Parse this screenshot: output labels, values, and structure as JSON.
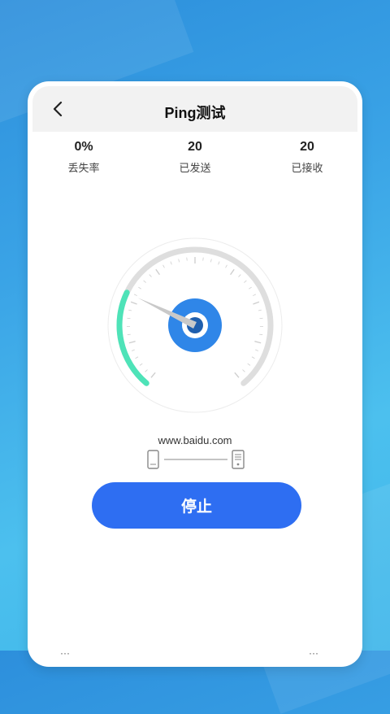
{
  "header": {
    "title": "Ping测试"
  },
  "stats": [
    {
      "value": "0%",
      "label": "丢失率"
    },
    {
      "value": "20",
      "label": "已发送"
    },
    {
      "value": "20",
      "label": "已接收"
    }
  ],
  "gauge": {
    "level_fraction": 0.27,
    "accent_color": "#4ee3b8",
    "center_color": "#2f86e8"
  },
  "target": {
    "host": "www.baidu.com"
  },
  "actions": {
    "stop_label": "停止"
  },
  "icons": [
    "back-arrow-icon",
    "phone-icon",
    "server-icon"
  ]
}
